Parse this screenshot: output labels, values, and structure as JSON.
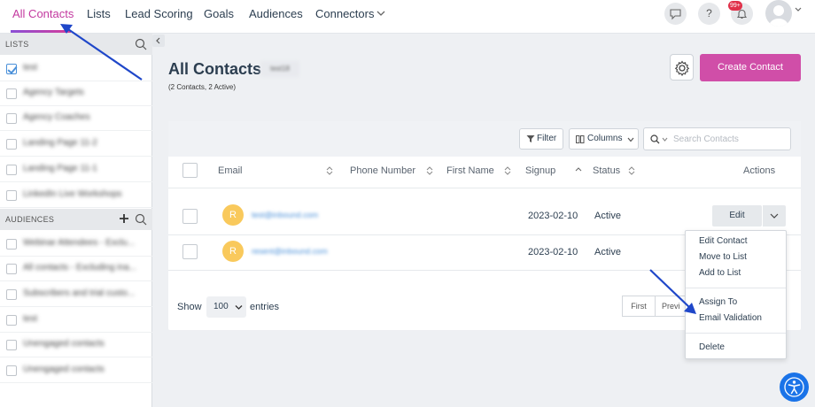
{
  "nav": {
    "items": [
      {
        "label": "All Contacts",
        "active": true
      },
      {
        "label": "Lists"
      },
      {
        "label": "Lead Scoring"
      },
      {
        "label": "Goals"
      },
      {
        "label": "Audiences"
      },
      {
        "label": "Connectors"
      }
    ],
    "notifications_badge": "99+",
    "help_label": "?",
    "accent_color": "#c3399f"
  },
  "sidebar": {
    "lists_header": "LISTS",
    "lists": [
      {
        "label": "test",
        "checked": true
      },
      {
        "label": "Agency Targets",
        "checked": false
      },
      {
        "label": "Agency Coaches",
        "checked": false
      },
      {
        "label": "Landing Page 11-2",
        "checked": false
      },
      {
        "label": "Landing Page 11-1",
        "checked": false
      },
      {
        "label": "LinkedIn Live Workshops",
        "checked": false
      }
    ],
    "audiences_header": "AUDIENCES",
    "audiences": [
      {
        "label": "Webinar Attendees - Exclu...",
        "checked": false
      },
      {
        "label": "All contacts - Excluding ina...",
        "checked": false
      },
      {
        "label": "Subscribers and trial custo...",
        "checked": false
      },
      {
        "label": "test",
        "checked": false
      },
      {
        "label": "Unengaged contacts",
        "checked": false
      },
      {
        "label": "Unengaged contacts",
        "checked": false
      }
    ]
  },
  "main": {
    "title": "All Contacts",
    "title_tag": "test18",
    "subtitle": "(2 Contacts, 2 Active)",
    "create_button": "Create Contact",
    "create_color": "#d04ea8",
    "toolbar": {
      "filter_label": "Filter",
      "columns_label": "Columns",
      "search_placeholder": "Search Contacts"
    },
    "table": {
      "headers": [
        "Email",
        "Phone Number",
        "First Name",
        "Signup",
        "Status",
        "Actions"
      ],
      "rows": [
        {
          "initial": "R",
          "email": "test@inbound.com",
          "signup": "2023-02-10",
          "status": "Active"
        },
        {
          "initial": "R",
          "email": "resent@inbound.com",
          "signup": "2023-02-10",
          "status": "Active"
        }
      ],
      "edit_label": "Edit"
    },
    "footer": {
      "show_label": "Show",
      "entries_value": "100",
      "entries_label": "entries",
      "first_label": "First",
      "prev_label": "Previ"
    }
  },
  "actions_menu": {
    "items": [
      "Edit Contact",
      "Move to List",
      "Add to List",
      "Assign To",
      "Email Validation",
      "Delete"
    ]
  }
}
